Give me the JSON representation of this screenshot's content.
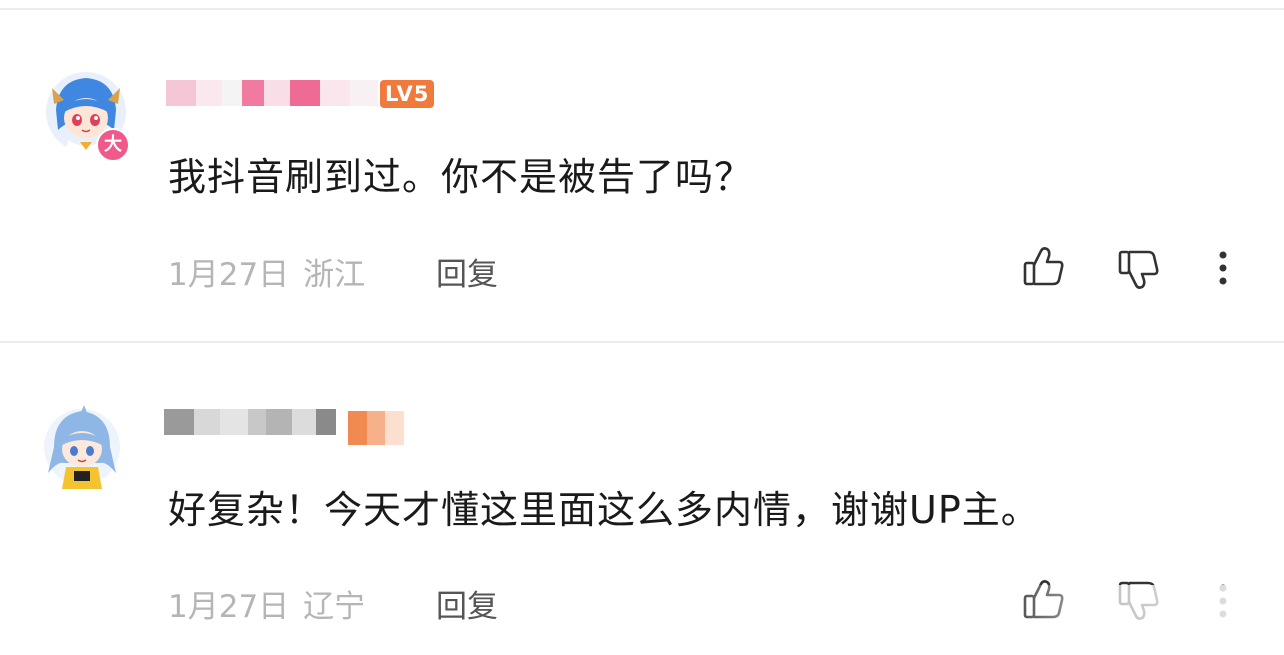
{
  "comments": [
    {
      "username": "",
      "level": "LV5",
      "avatar_badge": "大",
      "text": "我抖音刷到过。你不是被告了吗？",
      "date": "1月27日",
      "location": "浙江",
      "reply_label": "回复"
    },
    {
      "username": "",
      "level": "",
      "text": "好复杂！今天才懂这里面这么多内情，谢谢UP主。",
      "date": "1月27日",
      "location": "辽宁",
      "reply_label": "回复"
    }
  ],
  "colors": {
    "level_badge": "#f07a3c",
    "divider": "#ececec",
    "meta_text": "#b5b5b5",
    "body_text": "#1a1a1a",
    "badge_pink": "#f05a8a"
  },
  "icons": [
    "thumbs-up-icon",
    "thumbs-down-icon",
    "more-vertical-icon"
  ]
}
